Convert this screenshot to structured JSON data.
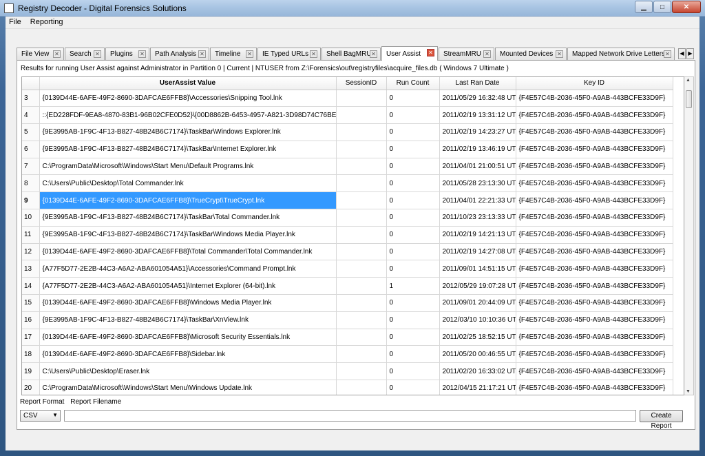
{
  "window": {
    "title": "Registry Decoder - Digital Forensics Solutions",
    "minimize": "▁",
    "maximize": "□",
    "close": "✕"
  },
  "menu": {
    "items": [
      "File",
      "Reporting"
    ]
  },
  "tabs": [
    {
      "label": "File View"
    },
    {
      "label": "Search"
    },
    {
      "label": "Plugins"
    },
    {
      "label": "Path Analysis"
    },
    {
      "label": "Timeline"
    },
    {
      "label": "IE Typed URLs"
    },
    {
      "label": "Shell BagMRU"
    },
    {
      "label": "User Assist"
    },
    {
      "label": "StreamMRU"
    },
    {
      "label": "Mounted Devices"
    },
    {
      "label": "Mapped Network Drive Letters"
    }
  ],
  "active_tab": "User Assist",
  "results_text": "Results for running User Assist against Administrator in Partition 0 | Current | NTUSER from Z:\\Forensics\\out\\registryfiles\\acquire_files.db ( Windows 7 Ultimate )",
  "table": {
    "columns": [
      "",
      "UserAssist Value",
      "SessionID",
      "Run Count",
      "Last Ran Date",
      "Key ID"
    ],
    "selected_row": "9",
    "rows": [
      {
        "num": "3",
        "value": "{0139D44E-6AFE-49F2-8690-3DAFCAE6FFB8}\\Accessories\\Snipping Tool.lnk",
        "session": "",
        "count": "0",
        "date": "2011/05/29 16:32:48 UTC",
        "key": "{F4E57C4B-2036-45F0-A9AB-443BCFE33D9F}"
      },
      {
        "num": "4",
        "value": "::{ED228FDF-9EA8-4870-83B1-96B02CFE0D52}\\{00D8862B-6453-4957-A821-3D98D74C76BE}",
        "session": "",
        "count": "0",
        "date": "2011/02/19 13:31:12 UTC",
        "key": "{F4E57C4B-2036-45F0-A9AB-443BCFE33D9F}"
      },
      {
        "num": "5",
        "value": "{9E3995AB-1F9C-4F13-B827-48B24B6C7174}\\TaskBar\\Windows Explorer.lnk",
        "session": "",
        "count": "0",
        "date": "2011/02/19 14:23:27 UTC",
        "key": "{F4E57C4B-2036-45F0-A9AB-443BCFE33D9F}"
      },
      {
        "num": "6",
        "value": "{9E3995AB-1F9C-4F13-B827-48B24B6C7174}\\TaskBar\\Internet Explorer.lnk",
        "session": "",
        "count": "0",
        "date": "2011/02/19 13:46:19 UTC",
        "key": "{F4E57C4B-2036-45F0-A9AB-443BCFE33D9F}"
      },
      {
        "num": "7",
        "value": "C:\\ProgramData\\Microsoft\\Windows\\Start Menu\\Default Programs.lnk",
        "session": "",
        "count": "0",
        "date": "2011/04/01 21:00:51 UTC",
        "key": "{F4E57C4B-2036-45F0-A9AB-443BCFE33D9F}"
      },
      {
        "num": "8",
        "value": "C:\\Users\\Public\\Desktop\\Total Commander.lnk",
        "session": "",
        "count": "0",
        "date": "2011/05/28 23:13:30 UTC",
        "key": "{F4E57C4B-2036-45F0-A9AB-443BCFE33D9F}"
      },
      {
        "num": "9",
        "value": "{0139D44E-6AFE-49F2-8690-3DAFCAE6FFB8}\\TrueCrypt\\TrueCrypt.lnk",
        "session": "",
        "count": "0",
        "date": "2011/04/01 22:21:33 UTC",
        "key": "{F4E57C4B-2036-45F0-A9AB-443BCFE33D9F}"
      },
      {
        "num": "10",
        "value": "{9E3995AB-1F9C-4F13-B827-48B24B6C7174}\\TaskBar\\Total Commander.lnk",
        "session": "",
        "count": "0",
        "date": "2011/10/23 23:13:33 UTC",
        "key": "{F4E57C4B-2036-45F0-A9AB-443BCFE33D9F}"
      },
      {
        "num": "11",
        "value": "{9E3995AB-1F9C-4F13-B827-48B24B6C7174}\\TaskBar\\Windows Media Player.lnk",
        "session": "",
        "count": "0",
        "date": "2011/02/19 14:21:13 UTC",
        "key": "{F4E57C4B-2036-45F0-A9AB-443BCFE33D9F}"
      },
      {
        "num": "12",
        "value": "{0139D44E-6AFE-49F2-8690-3DAFCAE6FFB8}\\Total Commander\\Total Commander.lnk",
        "session": "",
        "count": "0",
        "date": "2011/02/19 14:27:08 UTC",
        "key": "{F4E57C4B-2036-45F0-A9AB-443BCFE33D9F}"
      },
      {
        "num": "13",
        "value": "{A77F5D77-2E2B-44C3-A6A2-ABA601054A51}\\Accessories\\Command Prompt.lnk",
        "session": "",
        "count": "0",
        "date": "2011/09/01 14:51:15 UTC",
        "key": "{F4E57C4B-2036-45F0-A9AB-443BCFE33D9F}"
      },
      {
        "num": "14",
        "value": "{A77F5D77-2E2B-44C3-A6A2-ABA601054A51}\\Internet Explorer (64-bit).lnk",
        "session": "",
        "count": "1",
        "date": "2012/05/29 19:07:28 UTC",
        "key": "{F4E57C4B-2036-45F0-A9AB-443BCFE33D9F}"
      },
      {
        "num": "15",
        "value": "{0139D44E-6AFE-49F2-8690-3DAFCAE6FFB8}\\Windows Media Player.lnk",
        "session": "",
        "count": "0",
        "date": "2011/09/01 20:44:09 UTC",
        "key": "{F4E57C4B-2036-45F0-A9AB-443BCFE33D9F}"
      },
      {
        "num": "16",
        "value": "{9E3995AB-1F9C-4F13-B827-48B24B6C7174}\\TaskBar\\XnView.lnk",
        "session": "",
        "count": "0",
        "date": "2012/03/10 10:10:36 UTC",
        "key": "{F4E57C4B-2036-45F0-A9AB-443BCFE33D9F}"
      },
      {
        "num": "17",
        "value": "{0139D44E-6AFE-49F2-8690-3DAFCAE6FFB8}\\Microsoft Security Essentials.lnk",
        "session": "",
        "count": "0",
        "date": "2011/02/25 18:52:15 UTC",
        "key": "{F4E57C4B-2036-45F0-A9AB-443BCFE33D9F}"
      },
      {
        "num": "18",
        "value": "{0139D44E-6AFE-49F2-8690-3DAFCAE6FFB8}\\Sidebar.lnk",
        "session": "",
        "count": "0",
        "date": "2011/05/20 00:46:55 UTC",
        "key": "{F4E57C4B-2036-45F0-A9AB-443BCFE33D9F}"
      },
      {
        "num": "19",
        "value": "C:\\Users\\Public\\Desktop\\Eraser.lnk",
        "session": "",
        "count": "0",
        "date": "2011/02/20 16:33:02 UTC",
        "key": "{F4E57C4B-2036-45F0-A9AB-443BCFE33D9F}"
      },
      {
        "num": "20",
        "value": "C:\\ProgramData\\Microsoft\\Windows\\Start Menu\\Windows Update.lnk",
        "session": "",
        "count": "0",
        "date": "2012/04/15 21:17:21 UTC",
        "key": "{F4E57C4B-2036-45F0-A9AB-443BCFE33D9F}"
      }
    ]
  },
  "report": {
    "format_label": "Report Format",
    "filename_label": "Report Filename",
    "format_value": "CSV",
    "filename_value": "",
    "create_label": "Create Report"
  },
  "icons": {
    "tab_close": "✕",
    "scroll_left": "◀",
    "scroll_right": "▶",
    "scroll_up": "▲",
    "scroll_down": "▼",
    "dropdown": "▼"
  },
  "colors": {
    "selection": "#3399ff",
    "active_tab_close": "#d9533a"
  }
}
